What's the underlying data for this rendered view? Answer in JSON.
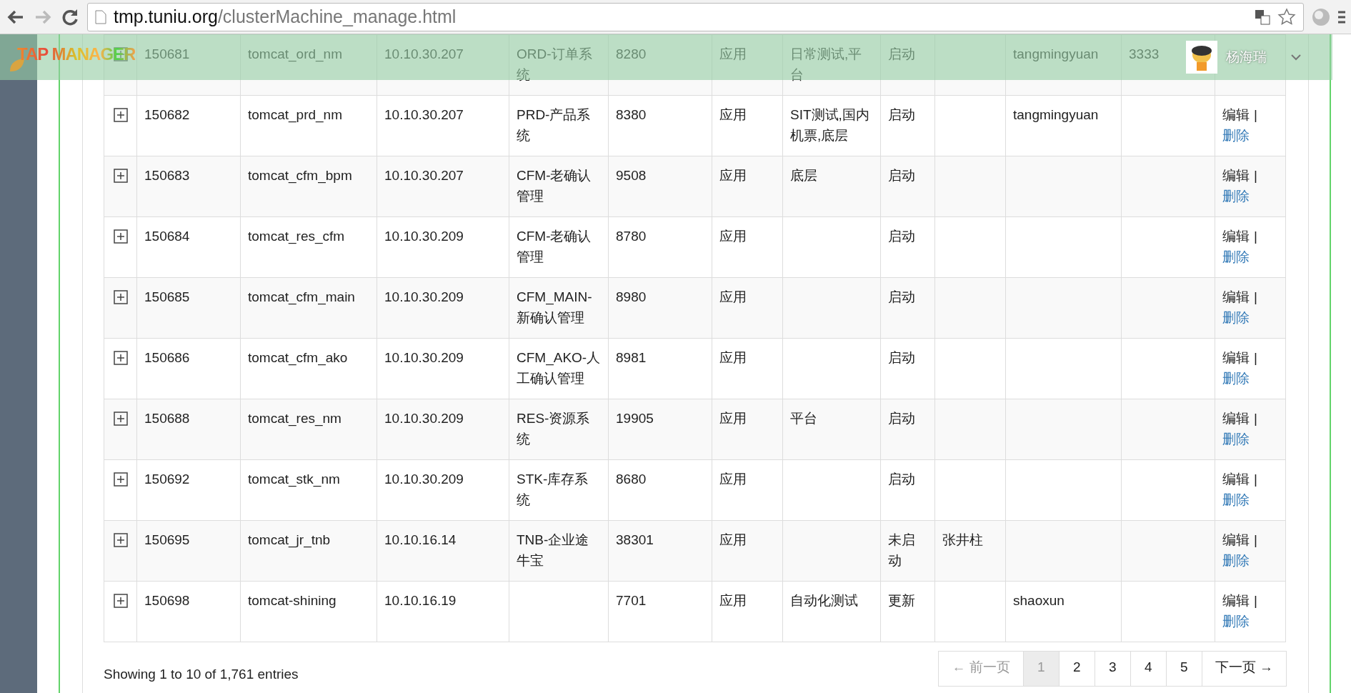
{
  "browser": {
    "url_host": "tmp.tuniu.org",
    "url_path": "/clusterMachine_manage.html"
  },
  "header": {
    "logo": "TAP MANAGER",
    "user": "杨海瑞"
  },
  "table": {
    "rows": [
      {
        "id": "150681",
        "name": "tomcat_ord_nm",
        "ip": "10.10.30.207",
        "system": "ORD-订单系统",
        "port": "8280",
        "type": "应用",
        "env": "日常测试,平台",
        "status": "启动",
        "column_9": "",
        "owner": "tangmingyuan",
        "column_11": "3333"
      },
      {
        "id": "150682",
        "name": "tomcat_prd_nm",
        "ip": "10.10.30.207",
        "system": "PRD-产品系统",
        "port": "8380",
        "type": "应用",
        "env": "SIT测试,国内机票,底层",
        "status": "启动",
        "column_9": "",
        "owner": "tangmingyuan",
        "column_11": "",
        "actions": {
          "edit": "编辑",
          "separator": "|",
          "delete": "删除"
        }
      },
      {
        "id": "150683",
        "name": "tomcat_cfm_bpm",
        "ip": "10.10.30.207",
        "system": "CFM-老确认管理",
        "port": "9508",
        "type": "应用",
        "env": "底层",
        "status": "启动",
        "column_9": "",
        "owner": "",
        "column_11": "",
        "actions": {
          "edit": "编辑",
          "separator": "|",
          "delete": "删除"
        }
      },
      {
        "id": "150684",
        "name": "tomcat_res_cfm",
        "ip": "10.10.30.209",
        "system": "CFM-老确认管理",
        "port": "8780",
        "type": "应用",
        "env": "",
        "status": "启动",
        "column_9": "",
        "owner": "",
        "column_11": "",
        "actions": {
          "edit": "编辑",
          "separator": "|",
          "delete": "删除"
        }
      },
      {
        "id": "150685",
        "name": "tomcat_cfm_main",
        "ip": "10.10.30.209",
        "system": "CFM_MAIN-新确认管理",
        "port": "8980",
        "type": "应用",
        "env": "",
        "status": "启动",
        "column_9": "",
        "owner": "",
        "column_11": "",
        "actions": {
          "edit": "编辑",
          "separator": "|",
          "delete": "删除"
        }
      },
      {
        "id": "150686",
        "name": "tomcat_cfm_ako",
        "ip": "10.10.30.209",
        "system": "CFM_AKO-人工确认管理",
        "port": "8981",
        "type": "应用",
        "env": "",
        "status": "启动",
        "column_9": "",
        "owner": "",
        "column_11": "",
        "actions": {
          "edit": "编辑",
          "separator": "|",
          "delete": "删除"
        }
      },
      {
        "id": "150688",
        "name": "tomcat_res_nm",
        "ip": "10.10.30.209",
        "system": "RES-资源系统",
        "port": "19905",
        "type": "应用",
        "env": "平台",
        "status": "启动",
        "column_9": "",
        "owner": "",
        "column_11": "",
        "actions": {
          "edit": "编辑",
          "separator": "|",
          "delete": "删除"
        }
      },
      {
        "id": "150692",
        "name": "tomcat_stk_nm",
        "ip": "10.10.30.209",
        "system": "STK-库存系统",
        "port": "8680",
        "type": "应用",
        "env": "",
        "status": "启动",
        "column_9": "",
        "owner": "",
        "column_11": "",
        "actions": {
          "edit": "编辑",
          "separator": "|",
          "delete": "删除"
        }
      },
      {
        "id": "150695",
        "name": "tomcat_jr_tnb",
        "ip": "10.10.16.14",
        "system": "TNB-企业途牛宝",
        "port": "38301",
        "type": "应用",
        "env": "",
        "status": "未启动",
        "column_9": "张井柱",
        "owner": "",
        "column_11": "",
        "actions": {
          "edit": "编辑",
          "separator": "|",
          "delete": "删除"
        }
      },
      {
        "id": "150698",
        "name": "tomcat-shining",
        "ip": "10.10.16.19",
        "system": "",
        "port": "7701",
        "type": "应用",
        "env": "自动化测试",
        "status": "更新",
        "column_9": "",
        "owner": "shaoxun",
        "column_11": "",
        "actions": {
          "edit": "编辑",
          "separator": "|",
          "delete": "删除"
        }
      }
    ]
  },
  "footer": {
    "info": "Showing 1 to 10 of 1,761 entries",
    "pagination": [
      {
        "label": "← 前一页",
        "kind": "prev",
        "disabled": true,
        "selected": false
      },
      {
        "label": "1",
        "kind": "page",
        "disabled": false,
        "selected": true
      },
      {
        "label": "2",
        "kind": "page",
        "disabled": false,
        "selected": false
      },
      {
        "label": "3",
        "kind": "page",
        "disabled": false,
        "selected": false
      },
      {
        "label": "4",
        "kind": "page",
        "disabled": false,
        "selected": false
      },
      {
        "label": "5",
        "kind": "page",
        "disabled": false,
        "selected": false
      },
      {
        "label": "下一页 →",
        "kind": "next",
        "disabled": false,
        "selected": false
      }
    ]
  }
}
